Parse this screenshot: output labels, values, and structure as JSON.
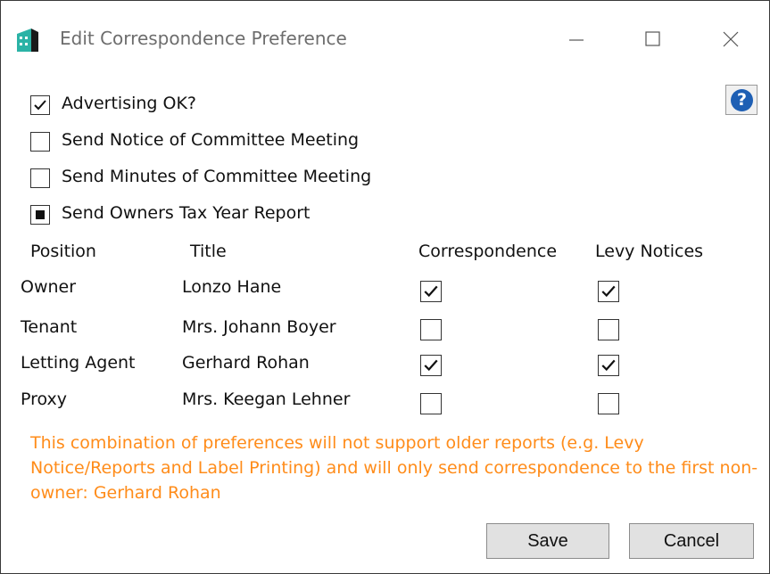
{
  "window": {
    "title": "Edit Correspondence Preference",
    "icons": {
      "app": "building-app-icon",
      "minimize": "minimize-icon",
      "maximize": "maximize-icon",
      "close": "close-icon"
    }
  },
  "options": [
    {
      "label": "Advertising OK?",
      "state": "checked"
    },
    {
      "label": "Send Notice of Committee Meeting",
      "state": "unchecked"
    },
    {
      "label": "Send Minutes of Committee Meeting",
      "state": "unchecked"
    },
    {
      "label": "Send Owners Tax Year Report",
      "state": "indeterminate"
    }
  ],
  "table": {
    "headers": [
      "Position",
      "Title",
      "Correspondence",
      "Levy Notices"
    ],
    "rows": [
      {
        "position": "Owner",
        "title": "Lonzo Hane",
        "correspondence": true,
        "levy_notices": true
      },
      {
        "position": "Tenant",
        "title": "Mrs. Johann Boyer",
        "correspondence": false,
        "levy_notices": false
      },
      {
        "position": "Letting Agent",
        "title": "Gerhard Rohan",
        "correspondence": true,
        "levy_notices": true
      },
      {
        "position": "Proxy",
        "title": "Mrs. Keegan Lehner",
        "correspondence": false,
        "levy_notices": false
      }
    ]
  },
  "warning": "This combination of preferences will not support older reports (e.g. Levy Notice/Reports and Label Printing) and will only send correspondence to the first non-owner: Gerhard Rohan",
  "buttons": {
    "save": "Save",
    "cancel": "Cancel"
  },
  "colors": {
    "warning": "#ff8c1a",
    "help_icon": "#1e5fb4",
    "app_icon": "#2bb3a6"
  }
}
